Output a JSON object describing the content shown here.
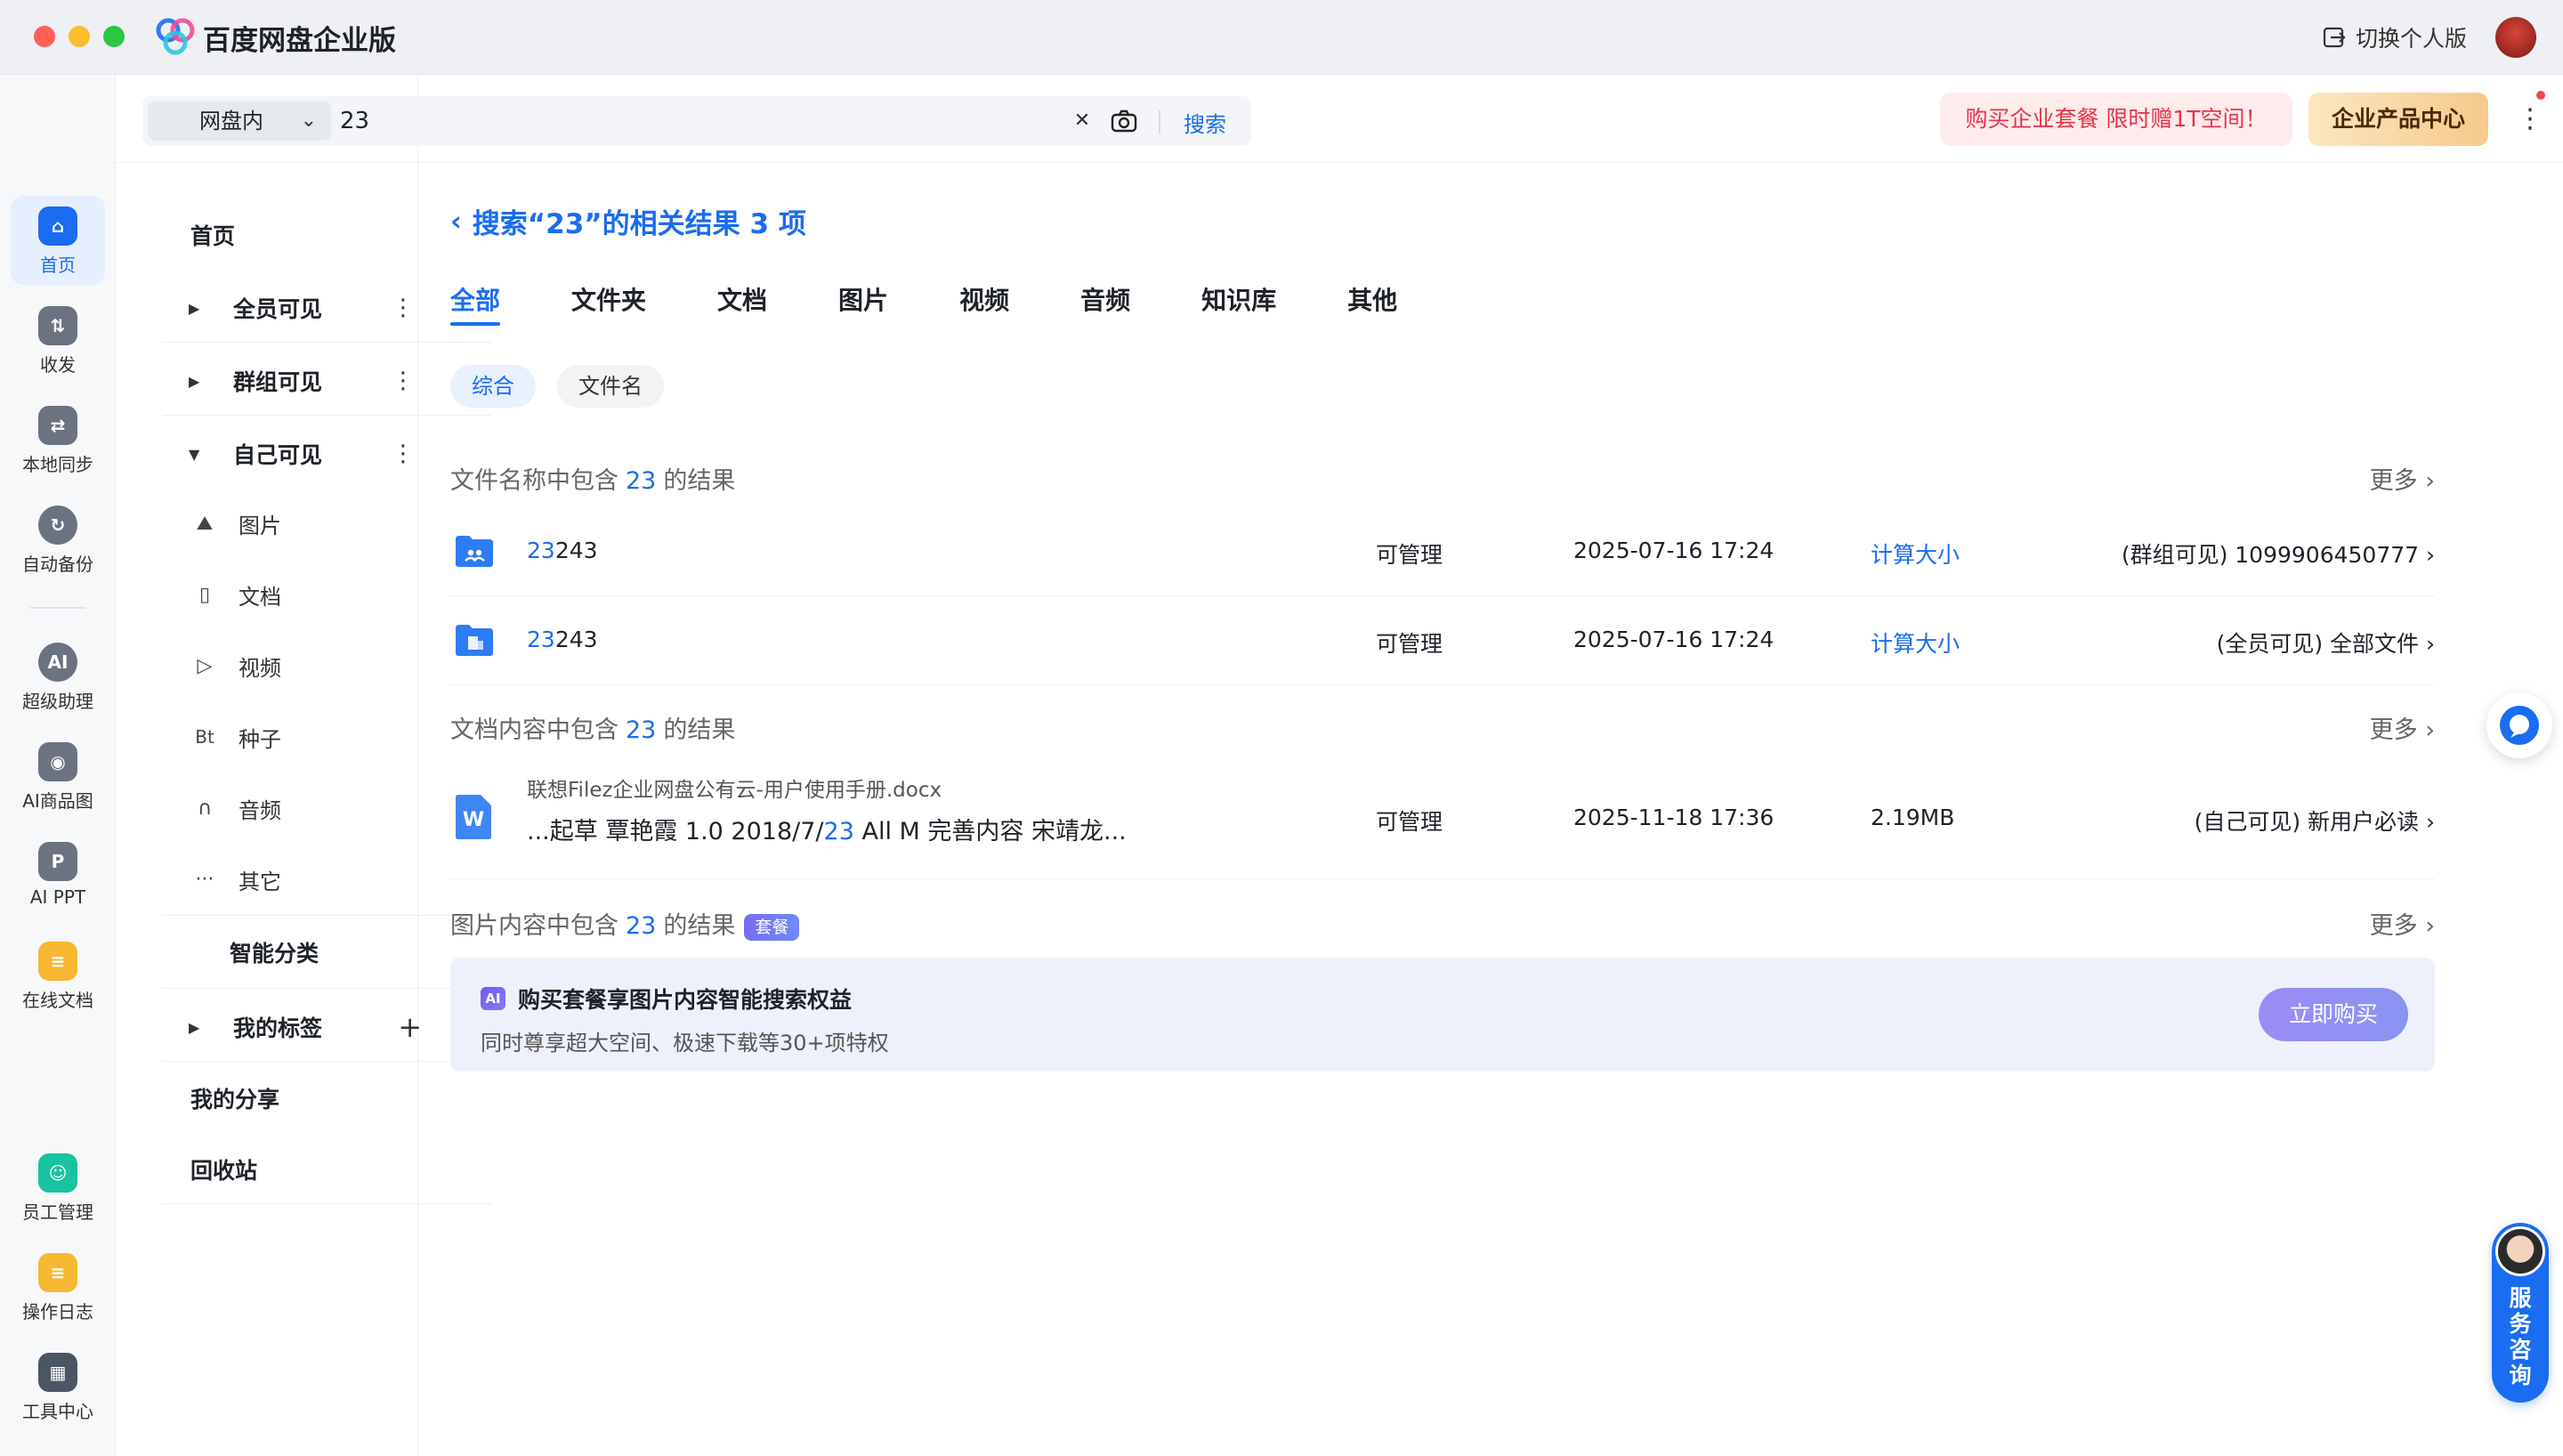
{
  "app": {
    "title": "百度网盘企业版",
    "switch_personal": "切换个人版"
  },
  "rail": [
    {
      "label": "首页",
      "icon": "home-icon",
      "active": true
    },
    {
      "label": "收发",
      "icon": "transfer-icon"
    },
    {
      "label": "本地同步",
      "icon": "sync-icon"
    },
    {
      "label": "自动备份",
      "icon": "backup-icon"
    },
    {
      "label": "超级助理",
      "icon": "ai-assistant-icon"
    },
    {
      "label": "AI商品图",
      "icon": "ai-product-icon"
    },
    {
      "label": "AI PPT",
      "icon": "ai-ppt-icon"
    },
    {
      "label": "在线文档",
      "icon": "online-doc-icon"
    },
    {
      "label": "员工管理",
      "icon": "staff-icon"
    },
    {
      "label": "操作日志",
      "icon": "log-icon"
    },
    {
      "label": "工具中心",
      "icon": "tools-icon"
    }
  ],
  "nav": {
    "home": "首页",
    "all_visible": "全员可见",
    "group_visible": "群组可见",
    "self_visible": "自己可见",
    "sub": [
      "图片",
      "文档",
      "视频",
      "种子",
      "音频",
      "其它"
    ],
    "sub_icon_bt": "Bt",
    "smart": "智能分类",
    "tags": "我的标签",
    "share": "我的分享",
    "recycle": "回收站"
  },
  "search": {
    "scope": "网盘内",
    "query": "23",
    "button": "搜索"
  },
  "header": {
    "promo": "购买企业套餐 限时赠1T空间！",
    "enterprise": "企业产品中心"
  },
  "results": {
    "title": "搜索“23”的相关结果 3 项",
    "tabs": [
      "全部",
      "文件夹",
      "文档",
      "图片",
      "视频",
      "音频",
      "知识库",
      "其他"
    ],
    "chips": [
      "综合",
      "文件名"
    ],
    "more": "更多",
    "sec1": {
      "pre": "文件名称中包含",
      "kw": "23",
      "post": "的结果"
    },
    "sec2": {
      "pre": "文档内容中包含",
      "kw": "23",
      "post": "的结果"
    },
    "sec3": {
      "pre": "图片内容中包含",
      "kw": "23",
      "post": "的结果",
      "badge": "套餐"
    },
    "rows": [
      {
        "hl": "23",
        "rest": "243",
        "perm": "可管理",
        "date": "2025-07-16 17:24",
        "size": "计算大小",
        "loc": "(群组可见) 1099906450777"
      },
      {
        "hl": "23",
        "rest": "243",
        "perm": "可管理",
        "date": "2025-07-16 17:24",
        "size": "计算大小",
        "loc": "(全员可见) 全部文件"
      }
    ],
    "doc": {
      "name": "联想Filez企业网盘公有云-用户使用手册.docx",
      "snippet_pre": "...起草 覃艳霞 1.0 2018/7/",
      "snippet_hl": "23",
      "snippet_post": " All M 完善内容 宋靖龙...",
      "perm": "可管理",
      "date": "2025-11-18 17:36",
      "size": "2.19MB",
      "loc": "(自己可见) 新用户必读",
      "icon_letter": "W"
    },
    "promo": {
      "title": "购买套餐享图片内容智能搜索权益",
      "sub": "同时尊享超大空间、极速下载等30+项特权",
      "button": "立即购买",
      "ai": "AI"
    }
  },
  "service": {
    "label": "服务咨询"
  },
  "colors": {
    "accent": "#1a6cf0",
    "promo_red": "#e8344a"
  }
}
